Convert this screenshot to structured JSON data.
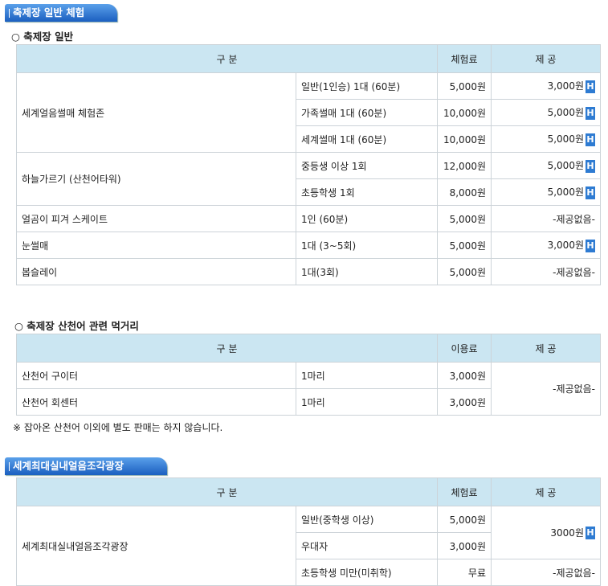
{
  "section1": {
    "tab": "축제장 일반 체험",
    "sub": "○ 축제장 일반",
    "headers": [
      "구 분",
      "체험료",
      "제 공"
    ],
    "rows": [
      {
        "category": "세계얼음썰매 체험존",
        "item": "일반(1인승) 1대 (60분)",
        "fee": "5,000원",
        "provide": "3,000원",
        "h": "H"
      },
      {
        "item": "가족썰매 1대 (60분)",
        "fee": "10,000원",
        "provide": "5,000원",
        "h": "H"
      },
      {
        "item": "세계썰매 1대 (60분)",
        "fee": "10,000원",
        "provide": "5,000원",
        "h": "H"
      },
      {
        "category": "하늘가르기 (산천어타워)",
        "item": "중등생 이상 1회",
        "fee": "12,000원",
        "provide": "5,000원",
        "h": "H"
      },
      {
        "item": "초등학생 1회",
        "fee": "8,000원",
        "provide": "5,000원",
        "h": "H"
      },
      {
        "category": "얼곰이 피겨 스케이트",
        "item": "1인 (60분)",
        "fee": "5,000원",
        "provide": "-제공없음-"
      },
      {
        "category": "눈썰매",
        "item": "1대 (3~5회)",
        "fee": "5,000원",
        "provide": "3,000원",
        "h": "H"
      },
      {
        "category": "봅슬레이",
        "item": "1대(3회)",
        "fee": "5,000원",
        "provide": "-제공없음-"
      }
    ]
  },
  "section2": {
    "sub": "○ 축제장 산천어 관련 먹거리",
    "headers": [
      "구 분",
      "이용료",
      "제 공"
    ],
    "rows": [
      {
        "category": "산천어 구이터",
        "item": "1마리",
        "fee": "3,000원"
      },
      {
        "category": "산천어 회센터",
        "item": "1마리",
        "fee": "3,000원"
      }
    ],
    "provide": "-제공없음-",
    "note": "※ 잡아온 산천어 이외에 별도 판매는 하지 않습니다."
  },
  "section3": {
    "tab": "세계최대실내얼음조각광장",
    "headers": [
      "구 분",
      "체험료",
      "제 공"
    ],
    "category": "세계최대실내얼음조각광장",
    "rows": [
      {
        "item": "일반(중학생 이상)",
        "fee": "5,000원"
      },
      {
        "item": "우대자",
        "fee": "3,000원"
      },
      {
        "item": "초등학생 미만(미취학)",
        "fee": "무료"
      }
    ],
    "provide1": "3000원",
    "provide1_h": "H",
    "provide2": "-제공없음-"
  }
}
